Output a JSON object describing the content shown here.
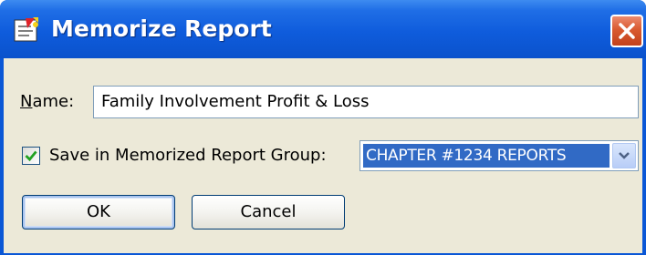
{
  "window": {
    "title": "Memorize Report",
    "icon": "memorize-report-icon",
    "close_icon": "close-x-icon"
  },
  "name_field": {
    "label_mnemonic": "N",
    "label_rest": "ame:",
    "value": "Family Involvement Profit & Loss"
  },
  "group": {
    "checkbox_checked": true,
    "label": "Save in Memorized Report Group:",
    "selected": "CHAPTER #1234 REPORTS"
  },
  "buttons": {
    "ok": "OK",
    "cancel": "Cancel"
  },
  "colors": {
    "title_bar": "#0a57d6",
    "dialog_face": "#ece9d8",
    "selection": "#316ac5",
    "close_button": "#d95a30",
    "checkmark": "#21a121"
  }
}
